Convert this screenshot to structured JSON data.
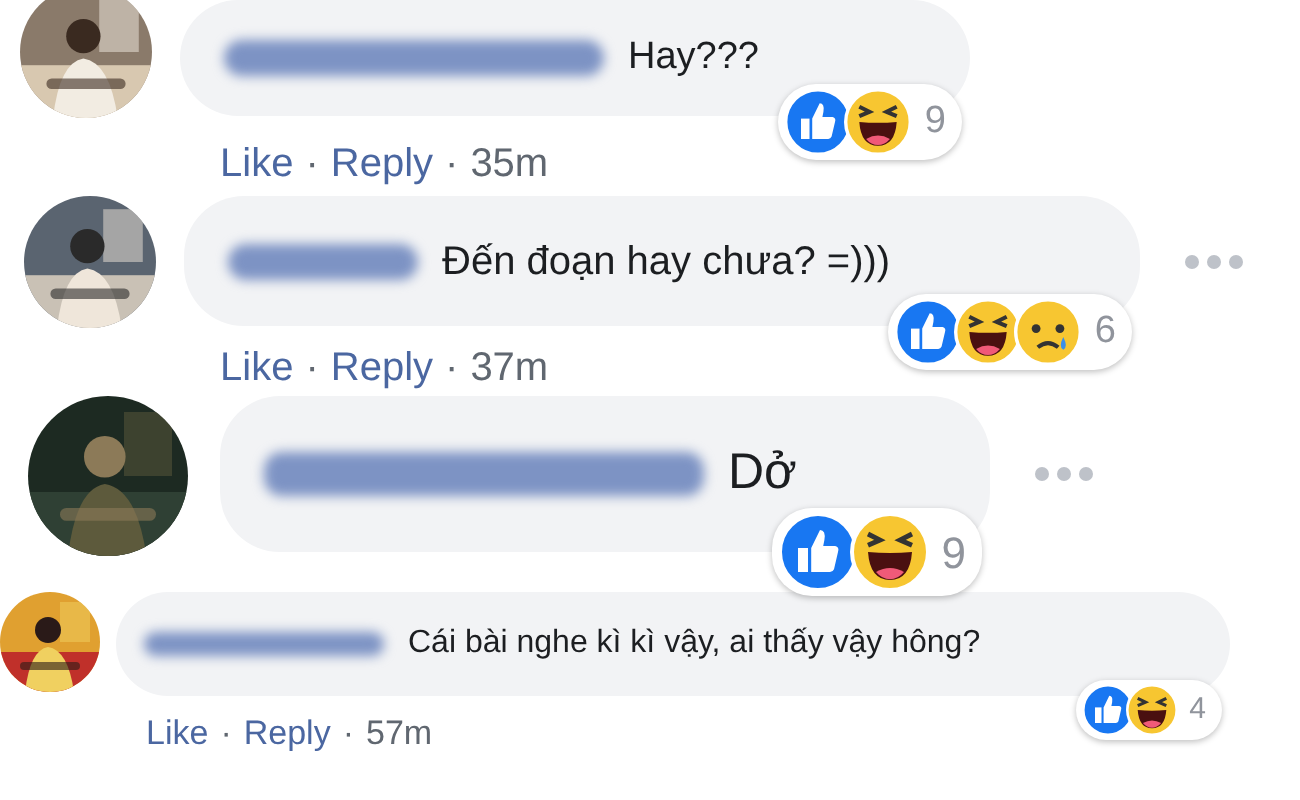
{
  "comments": [
    {
      "text": "Hay???",
      "more_menu": false,
      "reactions": [
        {
          "kind": "like"
        },
        {
          "kind": "haha"
        }
      ],
      "reaction_count": "9",
      "actions": [
        {
          "kind": "link",
          "text": "Like"
        },
        {
          "kind": "separator",
          "text": "·"
        },
        {
          "kind": "link",
          "text": "Reply"
        },
        {
          "kind": "separator",
          "text": "·"
        },
        {
          "kind": "time",
          "text": "35m"
        }
      ]
    },
    {
      "text": "Đến đoạn hay chưa? =)))",
      "more_menu": true,
      "reactions": [
        {
          "kind": "like"
        },
        {
          "kind": "haha"
        },
        {
          "kind": "sad"
        }
      ],
      "reaction_count": "6",
      "actions": [
        {
          "kind": "link",
          "text": "Like"
        },
        {
          "kind": "separator",
          "text": "·"
        },
        {
          "kind": "link",
          "text": "Reply"
        },
        {
          "kind": "separator",
          "text": "·"
        },
        {
          "kind": "time",
          "text": "37m"
        }
      ]
    },
    {
      "text": "Dở",
      "more_menu": true,
      "reactions": [
        {
          "kind": "like"
        },
        {
          "kind": "haha"
        }
      ],
      "reaction_count": "9"
    },
    {
      "text": "Cái bài nghe kì kì vậy, ai thấy vậy hông?",
      "more_menu": false,
      "reactions": [
        {
          "kind": "like"
        },
        {
          "kind": "haha"
        }
      ],
      "reaction_count": "4",
      "actions": [
        {
          "kind": "link",
          "text": "Like"
        },
        {
          "kind": "separator",
          "text": "·"
        },
        {
          "kind": "link",
          "text": "Reply"
        },
        {
          "kind": "separator",
          "text": "·"
        },
        {
          "kind": "time",
          "text": "57m"
        }
      ]
    }
  ]
}
